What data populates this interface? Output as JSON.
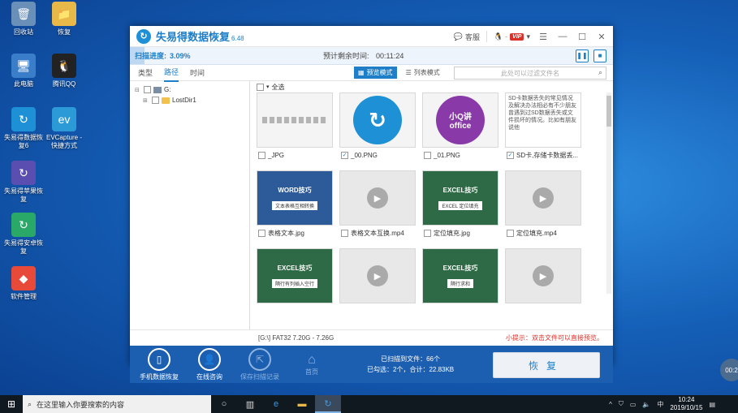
{
  "desktop": {
    "icons": [
      {
        "label": "回收站",
        "glyph": "🗑",
        "color": "#6a8fb8"
      },
      {
        "label": "恢复",
        "glyph": "📁",
        "color": "#e8b848"
      },
      {
        "label": "此电脑",
        "glyph": "🖥",
        "color": "#3a7dc8"
      },
      {
        "label": "腾讯QQ",
        "glyph": "🐧",
        "color": "#222222"
      },
      {
        "label": "失易得数据恢复6",
        "glyph": "↻",
        "color": "#1e90d6"
      },
      {
        "label": "EVCapture - 快捷方式",
        "glyph": "ev",
        "color": "#2d9ad8"
      },
      {
        "label": "失易得苹果恢复",
        "glyph": "↻",
        "color": "#5a4fb0"
      },
      {
        "label": "失易得安卓恢复",
        "glyph": "↻",
        "color": "#2aa868"
      },
      {
        "label": "软件管理",
        "glyph": "◆",
        "color": "#e84a3a"
      }
    ]
  },
  "window": {
    "title": "失易得数据恢复",
    "version": "6.48",
    "service_label": "客服",
    "vip_label": "VIP",
    "scan_label": "扫描进度:",
    "scan_value": "3.09%",
    "scan_fraction": 0.0309,
    "remain_label": "预计剩余时间:",
    "remain_value": "00:11:24",
    "tabs": [
      "类型",
      "路径",
      "时间"
    ],
    "active_tab": "路径",
    "preview_mode": "预览模式",
    "list_mode": "列表模式",
    "filter_placeholder": "此处可以过滤文件名",
    "tree": [
      {
        "label": "G:",
        "level": 0
      },
      {
        "label": "LostDir1",
        "level": 1
      }
    ],
    "select_all": "全选",
    "files": [
      {
        "name": "_JPG",
        "checked": false,
        "kind": "strip"
      },
      {
        "name": "_00.PNG",
        "checked": true,
        "kind": "logo"
      },
      {
        "name": "_01.PNG",
        "checked": false,
        "kind": "office",
        "logo_top": "小Q讲",
        "logo_bottom": "office"
      },
      {
        "name": "SD卡,存储卡数据丢...",
        "checked": true,
        "kind": "text",
        "text": "SD卡数据丢失的常见情况及解决办法相必有不少朋友曾遇到过SD数据丢失或文件损坏的情况。比如有朋友说他"
      },
      {
        "name": "表格文本.jpg",
        "checked": false,
        "kind": "blue",
        "badge": "WORD技巧",
        "sub": "文本表格互相转换"
      },
      {
        "name": "表格文本互换.mp4",
        "checked": false,
        "kind": "video"
      },
      {
        "name": "定位填充.jpg",
        "checked": false,
        "kind": "green",
        "badge": "EXCEL技巧",
        "sub": "EXCEL 定位填充"
      },
      {
        "name": "定位填充.mp4",
        "checked": false,
        "kind": "video"
      },
      {
        "name": "",
        "checked": false,
        "kind": "green",
        "badge": "EXCEL技巧",
        "sub": "隔行有列插入空行"
      },
      {
        "name": "",
        "checked": false,
        "kind": "video"
      },
      {
        "name": "",
        "checked": false,
        "kind": "green",
        "badge": "EXCEL技巧",
        "sub": "隔行求和"
      },
      {
        "name": "",
        "checked": false,
        "kind": "video"
      }
    ],
    "status_path": "[G:\\] FAT32 7.20G - 7.26G",
    "tip": "小提示：双击文件可以直接预览。",
    "bottom": {
      "phone_recover": "手机数据恢复",
      "online_consult": "在线咨询",
      "save_record": "保存扫描记录",
      "home": "首页",
      "scanned_files": "已扫描到文件：66个",
      "selected": "已勾选：2个，合计：22.83KB",
      "recover_button": "恢复"
    }
  },
  "taskbar": {
    "search_placeholder": "在这里输入你要搜索的内容",
    "ime": "中",
    "time": "10:24",
    "date": "2019/10/15",
    "corner": "00:2"
  }
}
